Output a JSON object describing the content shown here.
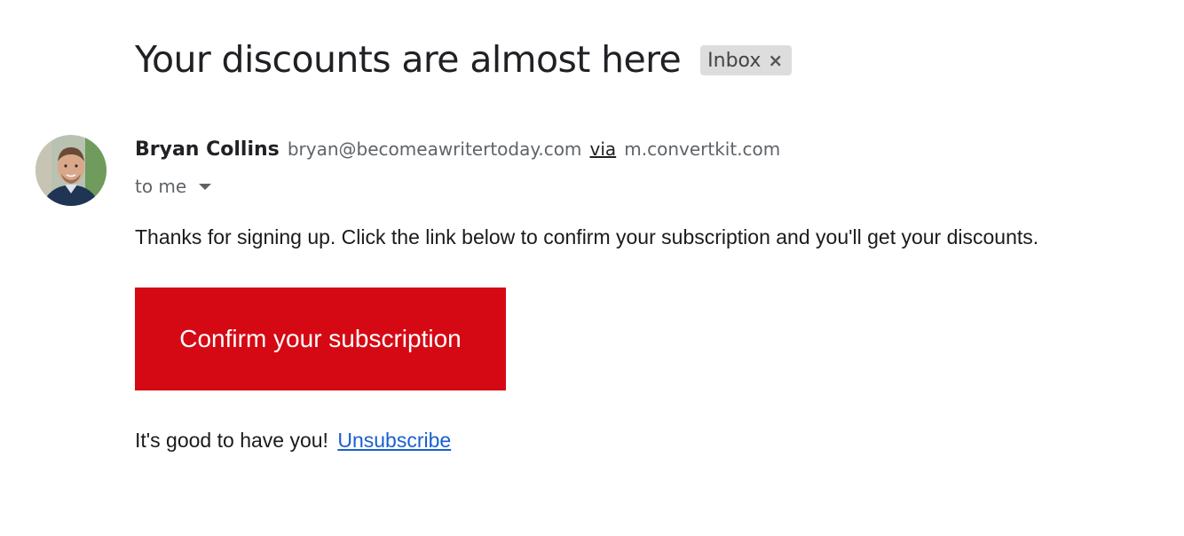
{
  "email": {
    "subject": "Your discounts are almost here",
    "label_chip": {
      "text": "Inbox",
      "close_icon": "×"
    }
  },
  "sender": {
    "name": "Bryan Collins",
    "email": "bryan@becomeawritertoday.com",
    "via_label": "via",
    "via_domain": "m.convertkit.com",
    "avatar_icon": "avatar-photo"
  },
  "recipient": {
    "text": "to me",
    "icon": "caret-down-icon"
  },
  "body": {
    "intro": "Thanks for signing up. Click the link below to confirm your subscription and you'll get your discounts.",
    "confirm_button": "Confirm your subscription",
    "closing": "It's good to have you!",
    "unsubscribe_link": "Unsubscribe"
  },
  "colors": {
    "button_bg": "#d50914",
    "link": "#1a5fd1",
    "chip_bg": "#dddddd"
  }
}
